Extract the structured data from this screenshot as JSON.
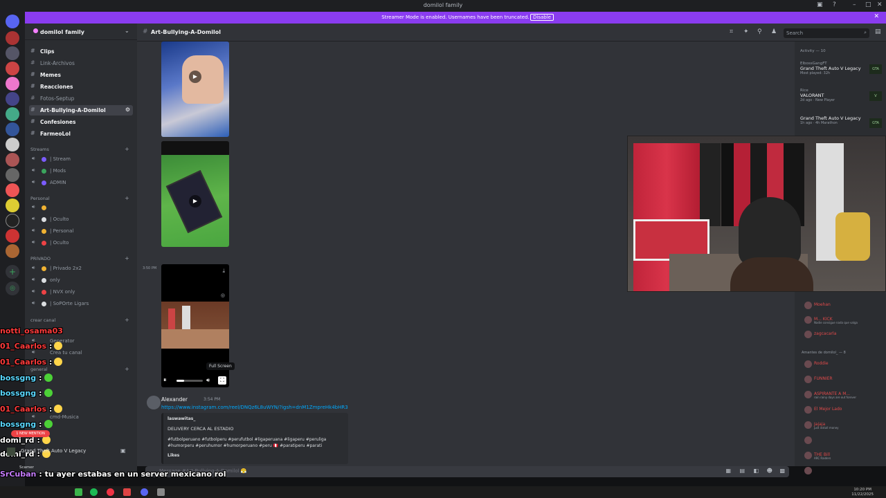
{
  "window": {
    "title": "domilol family"
  },
  "banner": {
    "message": "Streamer Mode is enabled. Usernames have been truncated.",
    "disable_label": "Disable"
  },
  "server": {
    "name": "domilol family"
  },
  "channels": [
    {
      "label": "Clips",
      "bold": true
    },
    {
      "label": "Link-Archivos",
      "bold": false
    },
    {
      "label": "Memes",
      "bold": true
    },
    {
      "label": "Reacciones",
      "bold": true
    },
    {
      "label": "Fotos-Septup",
      "bold": false
    },
    {
      "label": "Art-Bullying-A-Domilol",
      "bold": true,
      "active": true
    },
    {
      "label": "Confesiones",
      "bold": true
    },
    {
      "label": "FarmeoLol",
      "bold": true
    }
  ],
  "categories": {
    "streams": "Streams",
    "personal": "Personal",
    "privado": "PRIVADO",
    "crear_canal": "crear canal",
    "general": "general"
  },
  "voice_streams": [
    {
      "label": "| Stream",
      "color": "#7b5cff"
    },
    {
      "label": "| Mods",
      "color": "#3ba55d"
    },
    {
      "label": "ADMIN",
      "color": "#7b5cff"
    }
  ],
  "voice_personal": [
    {
      "label": "",
      "color": "#f0b232"
    },
    {
      "label": "| Oculto",
      "color": "#dbdee1"
    },
    {
      "label": "| Personal",
      "color": "#f0b232"
    },
    {
      "label": "| Oculto",
      "color": "#ed4245"
    }
  ],
  "voice_privado": [
    {
      "label": "| Privado 2x2",
      "color": "#f0b232"
    },
    {
      "label": "only",
      "color": "#dbdee1"
    },
    {
      "label": "| NVX only",
      "color": "#ed4245"
    },
    {
      "label": "| SoPOrte Ligars",
      "color": "#dbdee1"
    }
  ],
  "voice_crear": [
    {
      "label": "Generator"
    },
    {
      "label": "Crea tu canal"
    }
  ],
  "voice_general": [
    {
      "label": "cmd-Musica"
    }
  ],
  "channel_header": {
    "title": "Art-Bullying-A-Domilol",
    "search_placeholder": "Search"
  },
  "chat": {
    "timestamp_small": "3:50 PM",
    "fullscreen_tooltip": "Full Screen",
    "message": {
      "author": "Alexander",
      "time": "3:54 PM",
      "link": "https://www.instagram.com/reel/DNQz6L8uWYN/?igsh=dnM1ZmpreHk4bHR3",
      "embed_author": "laswawitas_",
      "embed_title": "DELIVERY CERCA AL ESTADIO",
      "embed_tags_1": "#futbolperuano #futbolperu #perufutbol #ligaperuana #ligaperu #peruliga",
      "embed_tags_2": "#humorperu #peruhumor #humorperuano #peru 🇵🇪 #paratiperu #parati",
      "embed_footer": "Likes"
    },
    "composer_placeholder": "Message #Art-Bullying-A-Domilol 😤"
  },
  "activity": {
    "header": "Activity — 10",
    "items": [
      {
        "name": "ElbossGangFT",
        "game": "Grand Theft Auto V Legacy",
        "sub": "Most played: 32h",
        "icon": "GTA"
      },
      {
        "name": "Rice",
        "game": "VALORANT",
        "sub": "2d ago · New Player",
        "icon": "V"
      },
      {
        "name": "",
        "game": "Grand Theft Auto V Legacy",
        "sub": "1h ago · 4h Marathon",
        "icon": "GTA"
      }
    ],
    "members_top": [
      {
        "name": "Moehan",
        "status": ""
      },
      {
        "name": "M... KICK",
        "status": "Nadie consigue nada que valga"
      },
      {
        "name": "zagcacarla",
        "status": ""
      }
    ],
    "group_label": "Amantes de domilol_ — 8",
    "members_bottom": [
      {
        "name": "Roddie",
        "status": ""
      },
      {
        "name": "FUNNIER",
        "status": ""
      },
      {
        "name": "ASPIRANTE A M...",
        "status": "rain rainy days are out forever"
      },
      {
        "name": "El Mejor Lado",
        "status": ""
      },
      {
        "name": "Jajaja",
        "status": "just install money"
      },
      {
        "name": "",
        "status": ""
      },
      {
        "name": "THE Bill",
        "status": "ARC Raiders"
      },
      {
        "name": "",
        "status": ""
      }
    ]
  },
  "overlay_chat": [
    {
      "user": "notti_osama03",
      "text": "",
      "color": "#ff3b3b"
    },
    {
      "user": "01_Caarlos",
      "text": ":",
      "color": "#ff3b3b"
    },
    {
      "user": "01_Caarlos",
      "text": ":",
      "color": "#ff3b3b"
    },
    {
      "user": "bossgng",
      "text": ":",
      "color": "#5ad8ff"
    },
    {
      "user": "bossgng",
      "text": ":",
      "color": "#5ad8ff"
    },
    {
      "user": "01_Caarlos",
      "text": ":",
      "color": "#ff3b3b"
    },
    {
      "user": "bossgng",
      "text": ":",
      "color": "#5ad8ff"
    },
    {
      "user": "domi_rd",
      "text": ":",
      "color": "#ffffff"
    },
    {
      "user": "domi_rd",
      "text": ":",
      "color": "#ffffff"
    },
    {
      "user": "SrCuban",
      "text": ": tu ayer estabas en un server mexicano rol",
      "color": "#c77dff"
    },
    {
      "user": "bossgng",
      "text": ":",
      "color": "#5ad8ff"
    }
  ],
  "user_panel": {
    "activity": "Grand Theft Auto V Legacy",
    "mention_badge": "1 NEW MENTION",
    "username": "Scamer"
  },
  "taskbar": {
    "time": "10:20 PM",
    "date": "11/22/2025"
  }
}
